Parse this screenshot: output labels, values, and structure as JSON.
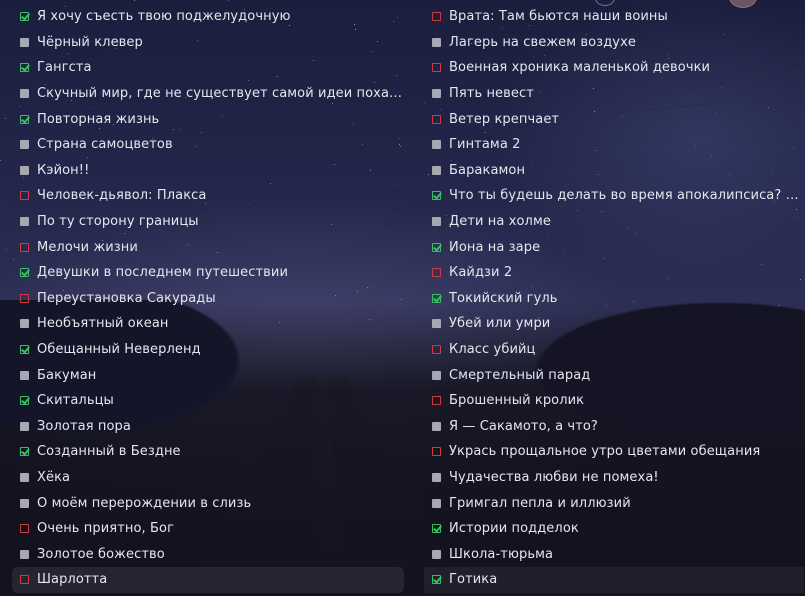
{
  "status_colors": {
    "completed": "#3bbf63",
    "dropped": "#d23b3b",
    "planned": "#a7a8b2"
  },
  "left_column": [
    {
      "title": "Я хочу съесть твою поджелудочную",
      "status": "completed"
    },
    {
      "title": "Чёрный клевер",
      "status": "planned"
    },
    {
      "title": "Гангста",
      "status": "completed"
    },
    {
      "title": "Скучный мир, где не существует самой идеи похабн...",
      "status": "planned"
    },
    {
      "title": "Повторная жизнь",
      "status": "completed"
    },
    {
      "title": "Страна самоцветов",
      "status": "planned"
    },
    {
      "title": "Кэйон!!",
      "status": "planned"
    },
    {
      "title": "Человек-дьявол: Плакса",
      "status": "dropped"
    },
    {
      "title": "По ту сторону границы",
      "status": "planned"
    },
    {
      "title": "Мелочи жизни",
      "status": "dropped"
    },
    {
      "title": "Девушки в последнем путешествии",
      "status": "completed"
    },
    {
      "title": "Переустановка Сакурады",
      "status": "dropped"
    },
    {
      "title": "Необъятный океан",
      "status": "planned"
    },
    {
      "title": "Обещанный Неверленд",
      "status": "completed"
    },
    {
      "title": "Бакуман",
      "status": "planned"
    },
    {
      "title": "Скитальцы",
      "status": "completed"
    },
    {
      "title": "Золотая пора",
      "status": "planned"
    },
    {
      "title": "Созданный в Бездне",
      "status": "completed"
    },
    {
      "title": "Хёка",
      "status": "planned"
    },
    {
      "title": "О моём перерождении в слизь",
      "status": "planned"
    },
    {
      "title": "Очень приятно, Бог",
      "status": "dropped"
    },
    {
      "title": "Золотое божество",
      "status": "planned"
    },
    {
      "title": "Шарлотта",
      "status": "dropped"
    }
  ],
  "right_column": [
    {
      "title": "Врата: Там бьются наши воины",
      "status": "dropped"
    },
    {
      "title": "Лагерь на свежем воздухе",
      "status": "planned"
    },
    {
      "title": "Военная хроника маленькой девочки",
      "status": "dropped"
    },
    {
      "title": "Пять невест",
      "status": "planned"
    },
    {
      "title": "Ветер крепчает",
      "status": "dropped"
    },
    {
      "title": "Гинтама 2",
      "status": "planned"
    },
    {
      "title": "Баракамон",
      "status": "planned"
    },
    {
      "title": "Что ты будешь делать во время апокалипсиса? Буд...",
      "status": "completed"
    },
    {
      "title": "Дети на холме",
      "status": "planned"
    },
    {
      "title": "Йона на заре",
      "status": "completed"
    },
    {
      "title": "Кайдзи 2",
      "status": "dropped"
    },
    {
      "title": "Токийский гуль",
      "status": "completed"
    },
    {
      "title": "Убей или умри",
      "status": "planned"
    },
    {
      "title": "Класс убийц",
      "status": "dropped"
    },
    {
      "title": "Смертельный парад",
      "status": "planned"
    },
    {
      "title": "Брошенный кролик",
      "status": "dropped"
    },
    {
      "title": "Я — Сакамото, а что?",
      "status": "planned"
    },
    {
      "title": "Укрась прощальное утро цветами обещания",
      "status": "dropped"
    },
    {
      "title": "Чудачества любви не помеха!",
      "status": "planned"
    },
    {
      "title": "Гримгал пепла и иллюзий",
      "status": "planned"
    },
    {
      "title": "Истории подделок",
      "status": "completed"
    },
    {
      "title": "Школа-тюрьма",
      "status": "planned"
    },
    {
      "title": "Готика",
      "status": "completed"
    }
  ]
}
